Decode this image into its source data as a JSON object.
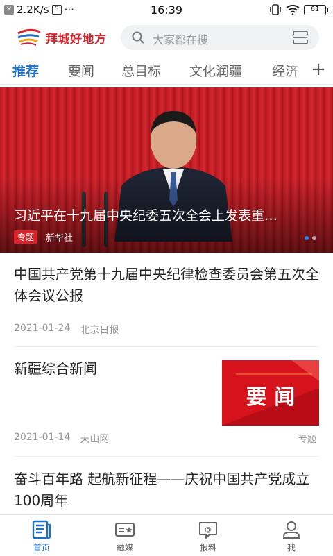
{
  "status": {
    "speed": "2.2K/s",
    "extra": "···",
    "time": "16:39",
    "battery": "61"
  },
  "header": {
    "logo_text": "拜城好地方",
    "search_placeholder": "大家都在搜"
  },
  "tabs": [
    "推荐",
    "要闻",
    "总目标",
    "文化润疆",
    "经济"
  ],
  "tab_plus": "+",
  "banner": {
    "title": "习近平在十九届中央纪委五次全会上发表重…",
    "tag": "专题",
    "source": "新华社"
  },
  "articles": [
    {
      "title": "中国共产党第十九届中央纪律检查委员会第五次全体会议公报",
      "date": "2021-01-24",
      "source": "北京日报"
    },
    {
      "title": "新疆综合新闻",
      "date": "2021-01-14",
      "source": "天山网",
      "tag": "专题",
      "thumb_text": "要 闻"
    },
    {
      "title": "奋斗百年路 起航新征程——庆祝中国共产党成立100周年"
    }
  ],
  "tabbar": [
    "首页",
    "融媒",
    "报料",
    "我"
  ],
  "colors": {
    "accent": "#1f6fc4",
    "brand_red": "#d8232a"
  }
}
